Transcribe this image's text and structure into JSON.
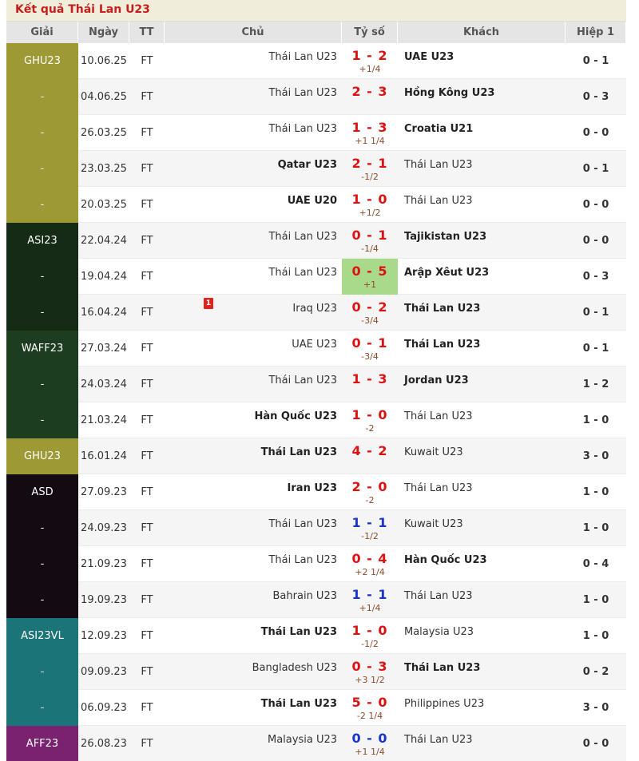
{
  "title": "Kết quả Thái Lan U23",
  "headers": {
    "league": "Giải",
    "date": "Ngày",
    "status": "TT",
    "home": "Chủ",
    "score": "Tỷ số",
    "away": "Khách",
    "half": "Hiệp 1"
  },
  "rows": [
    {
      "league": "GHU23",
      "league_color": "#9d9a35",
      "date": "10.06.25",
      "status": "FT",
      "home": "Thái Lan U23",
      "home_bold": false,
      "score": "1 - 2",
      "score_color": "red",
      "handicap": "+1/4",
      "away": "UAE U23",
      "away_bold": true,
      "half": "0 - 1"
    },
    {
      "league": "-",
      "league_color": "#9d9a35",
      "date": "04.06.25",
      "status": "FT",
      "home": "Thái Lan U23",
      "home_bold": false,
      "score": "2 - 3",
      "score_color": "red",
      "handicap": "",
      "away": "Hồng Kông U23",
      "away_bold": true,
      "half": "0 - 3"
    },
    {
      "league": "-",
      "league_color": "#9d9a35",
      "date": "26.03.25",
      "status": "FT",
      "home": "Thái Lan U23",
      "home_bold": false,
      "score": "1 - 3",
      "score_color": "red",
      "handicap": "+1 1/4",
      "away": "Croatia U21",
      "away_bold": true,
      "half": "0 - 0"
    },
    {
      "league": "-",
      "league_color": "#9d9a35",
      "date": "23.03.25",
      "status": "FT",
      "home": "Qatar U23",
      "home_bold": true,
      "score": "2 - 1",
      "score_color": "red",
      "handicap": "-1/2",
      "away": "Thái Lan U23",
      "away_bold": false,
      "half": "0 - 1"
    },
    {
      "league": "-",
      "league_color": "#9d9a35",
      "date": "20.03.25",
      "status": "FT",
      "home": "UAE U20",
      "home_bold": true,
      "score": "1 - 0",
      "score_color": "red",
      "handicap": "+1/2",
      "away": "Thái Lan U23",
      "away_bold": false,
      "half": "0 - 0"
    },
    {
      "league": "ASI23",
      "league_color": "#152b15",
      "date": "22.04.24",
      "status": "FT",
      "home": "Thái Lan U23",
      "home_bold": false,
      "score": "0 - 1",
      "score_color": "red",
      "handicap": "-1/4",
      "away": "Tajikistan U23",
      "away_bold": true,
      "half": "0 - 0"
    },
    {
      "league": "-",
      "league_color": "#152b15",
      "date": "19.04.24",
      "status": "FT",
      "home": "Thái Lan U23",
      "home_bold": false,
      "score": "0 - 5",
      "score_color": "red",
      "handicap": "+1",
      "highlight": true,
      "away": "Arập Xêut U23",
      "away_bold": true,
      "half": "0 - 3"
    },
    {
      "league": "-",
      "league_color": "#152b15",
      "date": "16.04.24",
      "status": "FT",
      "home": "Iraq U23",
      "home_bold": false,
      "red_card": "1",
      "score": "0 - 2",
      "score_color": "red",
      "handicap": "-3/4",
      "away": "Thái Lan U23",
      "away_bold": true,
      "half": "0 - 1"
    },
    {
      "league": "WAFF23",
      "league_color": "#1c3d1f",
      "date": "27.03.24",
      "status": "FT",
      "home": "UAE U23",
      "home_bold": false,
      "score": "0 - 1",
      "score_color": "red",
      "handicap": "-3/4",
      "away": "Thái Lan U23",
      "away_bold": true,
      "half": "0 - 1"
    },
    {
      "league": "-",
      "league_color": "#1c3d1f",
      "date": "24.03.24",
      "status": "FT",
      "home": "Thái Lan U23",
      "home_bold": false,
      "score": "1 - 3",
      "score_color": "red",
      "handicap": "",
      "away": "Jordan U23",
      "away_bold": true,
      "half": "1 - 2"
    },
    {
      "league": "-",
      "league_color": "#1c3d1f",
      "date": "21.03.24",
      "status": "FT",
      "home": "Hàn Quốc U23",
      "home_bold": true,
      "score": "1 - 0",
      "score_color": "red",
      "handicap": "-2",
      "away": "Thái Lan U23",
      "away_bold": false,
      "half": "1 - 0"
    },
    {
      "league": "GHU23",
      "league_color": "#9d9a35",
      "date": "16.01.24",
      "status": "FT",
      "home": "Thái Lan U23",
      "home_bold": true,
      "score": "4 - 2",
      "score_color": "red",
      "handicap": "",
      "away": "Kuwait U23",
      "away_bold": false,
      "half": "3 - 0"
    },
    {
      "league": "ASD",
      "league_color": "#140a12",
      "date": "27.09.23",
      "status": "FT",
      "home": "Iran U23",
      "home_bold": true,
      "score": "2 - 0",
      "score_color": "red",
      "handicap": "-2",
      "away": "Thái Lan U23",
      "away_bold": false,
      "half": "1 - 0"
    },
    {
      "league": "-",
      "league_color": "#140a12",
      "date": "24.09.23",
      "status": "FT",
      "home": "Thái Lan U23",
      "home_bold": false,
      "score": "1 - 1",
      "score_color": "blue",
      "handicap": "-1/2",
      "away": "Kuwait U23",
      "away_bold": false,
      "half": "1 - 0"
    },
    {
      "league": "-",
      "league_color": "#140a12",
      "date": "21.09.23",
      "status": "FT",
      "home": "Thái Lan U23",
      "home_bold": false,
      "score": "0 - 4",
      "score_color": "red",
      "handicap": "+2 1/4",
      "away": "Hàn Quốc U23",
      "away_bold": true,
      "half": "0 - 4"
    },
    {
      "league": "-",
      "league_color": "#140a12",
      "date": "19.09.23",
      "status": "FT",
      "home": "Bahrain U23",
      "home_bold": false,
      "score": "1 - 1",
      "score_color": "blue",
      "handicap": "+1/4",
      "away": "Thái Lan U23",
      "away_bold": false,
      "half": "1 - 0"
    },
    {
      "league": "ASI23VL",
      "league_color": "#1b7578",
      "date": "12.09.23",
      "status": "FT",
      "home": "Thái Lan U23",
      "home_bold": true,
      "score": "1 - 0",
      "score_color": "red",
      "handicap": "-1/2",
      "away": "Malaysia U23",
      "away_bold": false,
      "half": "1 - 0"
    },
    {
      "league": "-",
      "league_color": "#1b7578",
      "date": "09.09.23",
      "status": "FT",
      "home": "Bangladesh U23",
      "home_bold": false,
      "score": "0 - 3",
      "score_color": "red",
      "handicap": "+3 1/2",
      "away": "Thái Lan U23",
      "away_bold": true,
      "half": "0 - 2"
    },
    {
      "league": "-",
      "league_color": "#1b7578",
      "date": "06.09.23",
      "status": "FT",
      "home": "Thái Lan U23",
      "home_bold": true,
      "score": "5 - 0",
      "score_color": "red",
      "handicap": "-2 1/4",
      "away": "Philippines U23",
      "away_bold": false,
      "half": "3 - 0"
    },
    {
      "league": "AFF23",
      "league_color": "#7a2270",
      "date": "26.08.23",
      "status": "FT",
      "home": "Malaysia U23",
      "home_bold": false,
      "score": "0 - 0",
      "score_color": "blue",
      "handicap": "+1 1/4",
      "away": "Thái Lan U23",
      "away_bold": false,
      "half": "0 - 0"
    }
  ]
}
